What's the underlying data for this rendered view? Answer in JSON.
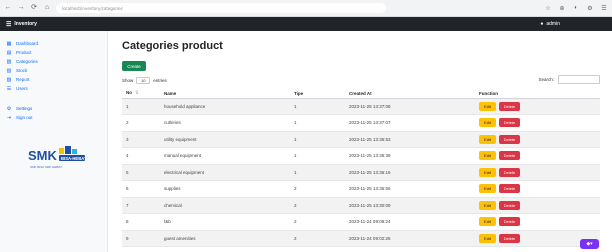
{
  "browser": {
    "url": "localhost/inventory/categories",
    "nav_icons": [
      "←",
      "→",
      "⟳",
      "⌂"
    ],
    "toolbar_icons": [
      "☆",
      "⊕",
      "◐",
      "⚙",
      "☰"
    ]
  },
  "header": {
    "brand": "Inventory",
    "user": "admin"
  },
  "sidebar": {
    "items": [
      {
        "label": "Dashboard",
        "icon": "dashboard-icon",
        "glyph": "▦"
      },
      {
        "label": "Product",
        "icon": "box-icon",
        "glyph": "▤"
      },
      {
        "label": "Categories",
        "icon": "tag-icon",
        "glyph": "▧"
      },
      {
        "label": "Stock",
        "icon": "layers-icon",
        "glyph": "▥"
      },
      {
        "label": "Report",
        "icon": "chart-icon",
        "glyph": "▨"
      },
      {
        "label": "Users",
        "icon": "users-icon",
        "glyph": "☰"
      }
    ],
    "items2": [
      {
        "label": "Settings",
        "icon": "gear-icon",
        "glyph": "⚙"
      },
      {
        "label": "Sign out",
        "icon": "signout-icon",
        "glyph": "⇥"
      }
    ],
    "logo": {
      "text": "SMK",
      "subtext": "BISA-HEBAT",
      "tagline": "SMK BISA SMK HEBAT"
    }
  },
  "main": {
    "title": "Categories product",
    "create_label": "Create",
    "show_label": "Show",
    "entries_value": "10",
    "entries_label": "entries",
    "search_label": "Search:"
  },
  "table": {
    "headers": {
      "no": "No",
      "name": "Name",
      "tipe": "Tipe",
      "created": "Created At",
      "function": "Function"
    },
    "edit_label": "Edit",
    "delete_label": "Delete",
    "rows": [
      {
        "no": "1",
        "name": "household appliance",
        "tipe": "1",
        "created": "2023-11-25 13:37:08"
      },
      {
        "no": "2",
        "name": "cutleries",
        "tipe": "1",
        "created": "2023-11-25 13:37:07"
      },
      {
        "no": "3",
        "name": "utility equipment",
        "tipe": "1",
        "created": "2023-11-25 13:36:53"
      },
      {
        "no": "4",
        "name": "manual equipment",
        "tipe": "1",
        "created": "2023-11-25 13:36:39"
      },
      {
        "no": "5",
        "name": "electrical equipment",
        "tipe": "1",
        "created": "2023-11-25 13:36:16"
      },
      {
        "no": "6",
        "name": "supplies",
        "tipe": "2",
        "created": "2023-11-25 13:35:55"
      },
      {
        "no": "7",
        "name": "chemical",
        "tipe": "2",
        "created": "2023-11-25 13:30:09"
      },
      {
        "no": "8",
        "name": "f&b",
        "tipe": "2",
        "created": "2023-11-24 09:08:24"
      },
      {
        "no": "9",
        "name": "guest amenities",
        "tipe": "2",
        "created": "2023-11-24 09:02:26"
      }
    ]
  },
  "colors": {
    "create": "#198754",
    "edit": "#ffc107",
    "delete": "#dc3545",
    "link": "#0d6efd",
    "topbar": "#212529",
    "float": "#7b2ff7"
  }
}
